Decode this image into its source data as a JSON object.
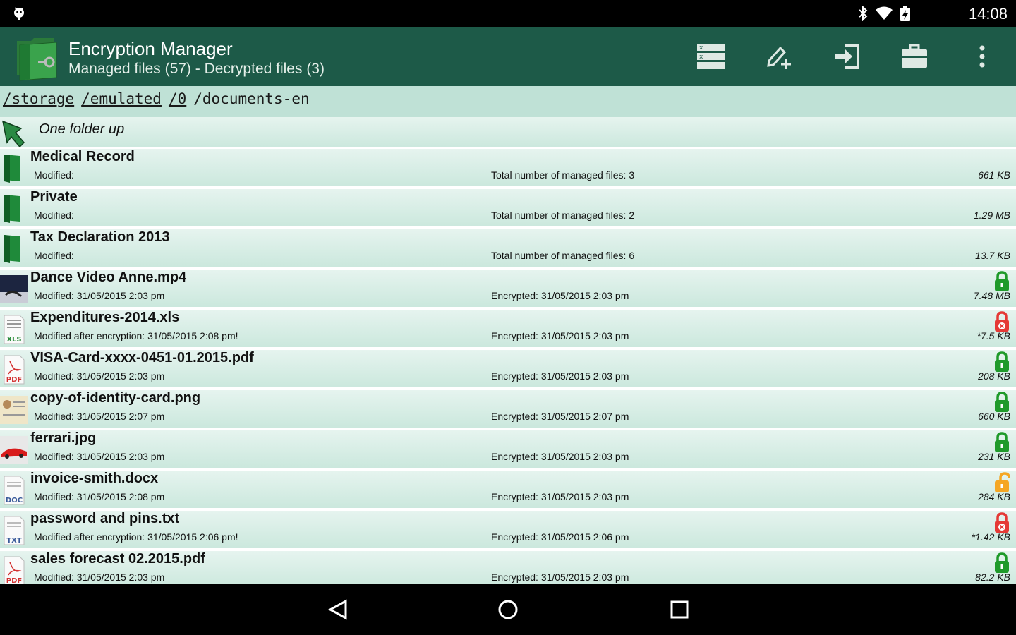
{
  "status_bar": {
    "time": "14:08",
    "icons": [
      "android-debug-icon",
      "bluetooth-icon",
      "wifi-icon",
      "battery-charging-icon"
    ]
  },
  "app_bar": {
    "title": "Encryption Manager",
    "subtitle": "Managed files (57) - Decrypted files (3)",
    "actions": [
      "select-list-icon",
      "add-edit-icon",
      "import-icon",
      "briefcase-icon",
      "overflow-menu-icon"
    ],
    "color": "#1d5a48"
  },
  "path": {
    "segments": [
      "/storage",
      "/emulated",
      "/0"
    ],
    "current": "/documents-en"
  },
  "list": {
    "up_label": "One folder up",
    "folders": [
      {
        "name": "Medical Record",
        "modified": "Modified:",
        "info": "Total number of managed files: 3",
        "size": "661 KB"
      },
      {
        "name": "Private",
        "modified": "Modified:",
        "info": "Total number of managed files: 2",
        "size": "1.29 MB"
      },
      {
        "name": "Tax Declaration 2013",
        "modified": "Modified:",
        "info": "Total number of managed files: 6",
        "size": "13.7 KB"
      }
    ],
    "files": [
      {
        "name": "Dance Video Anne.mp4",
        "modified": "Modified: 31/05/2015 2:03 pm",
        "info": "Encrypted: 31/05/2015 2:03 pm",
        "size": "7.48 MB",
        "type": "video",
        "lock": "locked"
      },
      {
        "name": "Expenditures-2014.xls",
        "modified": "Modified after encryption: 31/05/2015 2:08 pm!",
        "info": "Encrypted: 31/05/2015 2:03 pm",
        "size": "*7.5 KB",
        "type": "xls",
        "lock": "modified"
      },
      {
        "name": "VISA-Card-xxxx-0451-01.2015.pdf",
        "modified": "Modified: 31/05/2015 2:03 pm",
        "info": "Encrypted: 31/05/2015 2:03 pm",
        "size": "208 KB",
        "type": "pdf",
        "lock": "locked"
      },
      {
        "name": "copy-of-identity-card.png",
        "modified": "Modified: 31/05/2015 2:07 pm",
        "info": "Encrypted: 31/05/2015 2:07 pm",
        "size": "660 KB",
        "type": "id",
        "lock": "locked"
      },
      {
        "name": "ferrari.jpg",
        "modified": "Modified: 31/05/2015 2:03 pm",
        "info": "Encrypted: 31/05/2015 2:03 pm",
        "size": "231 KB",
        "type": "car",
        "lock": "locked"
      },
      {
        "name": "invoice-smith.docx",
        "modified": "Modified: 31/05/2015 2:08 pm",
        "info": "Encrypted: 31/05/2015 2:03 pm",
        "size": "284 KB",
        "type": "doc",
        "lock": "unlocked"
      },
      {
        "name": "password and pins.txt",
        "modified": "Modified after encryption: 31/05/2015 2:06 pm!",
        "info": "Encrypted: 31/05/2015 2:06 pm",
        "size": "*1.42 KB",
        "type": "txt",
        "lock": "modified"
      },
      {
        "name": "sales forecast 02.2015.pdf",
        "modified": "Modified: 31/05/2015 2:03 pm",
        "info": "Encrypted: 31/05/2015 2:03 pm",
        "size": "82.2 KB",
        "type": "pdf",
        "lock": "locked"
      }
    ],
    "file_type_labels": {
      "xls": "XLS",
      "pdf": "PDF",
      "doc": "DOC",
      "txt": "TXT"
    },
    "colors": {
      "locked": "#1f9a2a",
      "modified": "#e53935",
      "unlocked": "#f5a623"
    }
  },
  "nav_bar": [
    "back-icon",
    "home-icon",
    "recents-icon"
  ]
}
